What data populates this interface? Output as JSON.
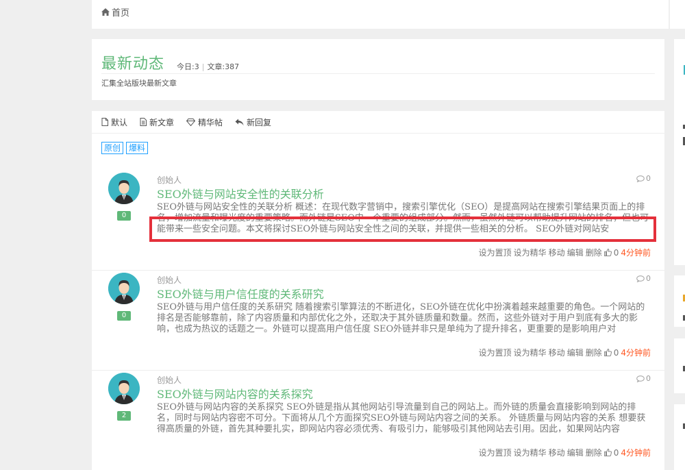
{
  "breadcrumb": {
    "home": "首页"
  },
  "header": {
    "title": "最新动态",
    "today": "今日:3",
    "articles": "文章:387",
    "desc": "汇集全站版块最新文章"
  },
  "tabs": [
    {
      "label": "默认",
      "icon": "file-icon"
    },
    {
      "label": "新文章",
      "icon": "document-icon"
    },
    {
      "label": "精华帖",
      "icon": "diamond-icon"
    },
    {
      "label": "新回复",
      "icon": "reply-icon"
    }
  ],
  "tags": [
    "原创",
    "爆料"
  ],
  "posts": [
    {
      "author": "创始人",
      "comments": "0",
      "title": "SEO外链与网站安全性的关联分析",
      "excerpt": "SEO外链与网站安全性的关联分析 概述：在现代数字营销中，搜索引擎优化（SEO）是提高网站在搜索引擎结果页面上的排名，增加流量和曝光度的重要策略。而外链是SEO中一个重要的组成部分。然而，虽然外链可以帮助提升网站的排名，但也可能带来一些安全问题。本文将探讨SEO外链与网站安全性之间的关联，并提供一些相关的分析。 SEO外链对网站安",
      "count": "0",
      "likes": "0",
      "time": "4分钟前"
    },
    {
      "author": "创始人",
      "comments": "0",
      "title": "SEO外链与用户信任度的关系研究",
      "excerpt": "SEO外链与用户信任度的关系研究 随着搜索引擎算法的不断进化，SEO外链在优化中扮演着越来越重要的角色。一个网站的排名是否能够靠前，除了内容质量和内部优化之外，还取决于其外链质量和数量。然而，这些外链对于用户到底有多大的影响，也成为热议的话题之一。外链可以提高用户信任度 SEO外链并非只是单纯为了提升排名，更重要的是影响用户对",
      "count": "0",
      "likes": "0",
      "time": "4分钟前"
    },
    {
      "author": "创始人",
      "comments": "0",
      "title": "SEO外链与网站内容的关系探究",
      "excerpt": "SEO外链与网站内容的关系探究 SEO外链是指从其他网站引导流量到自己的网站上。而外链的质量会直接影响到网站的排名，同时与网站内容密不可分。下面将从几个方面探究SEO外链与网站内容之间的关系。 外链质量与网站内容的关系 想要获得高质量的外链，首先其种要扎实，即网站内容必须优秀、有吸引力，能够吸引其他网站去引用。因此，如果网站内容",
      "count": "2",
      "likes": "0",
      "time": "4分钟前"
    }
  ],
  "actions": {
    "set_top": "设为置顶",
    "set_digest": "设为精华",
    "move": "移动",
    "edit": "编辑",
    "delete": "删除"
  },
  "colors": {
    "accent_green": "#5fb878",
    "tag_blue": "#1e9fff",
    "time_orange": "#ff5722",
    "highlight_red": "#e4303b",
    "avatar_teal": "#3bb5c2"
  }
}
